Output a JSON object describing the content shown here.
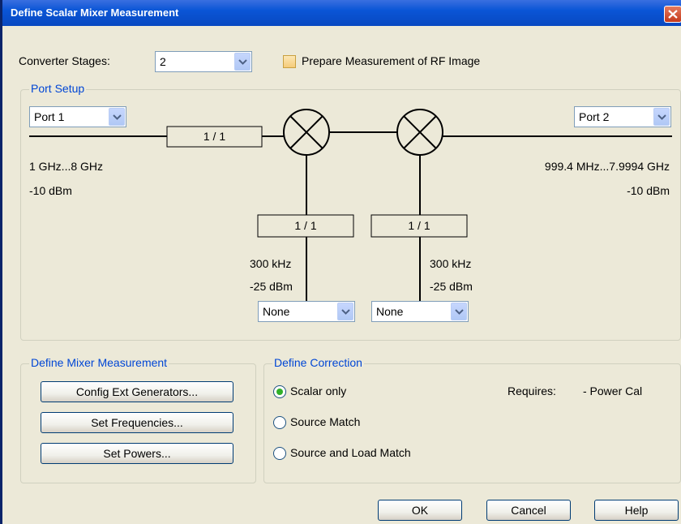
{
  "window": {
    "title": "Define Scalar Mixer Measurement"
  },
  "converter": {
    "label": "Converter Stages:",
    "value": "2"
  },
  "rf_image": {
    "label": "Prepare Measurement of RF Image",
    "checked": false
  },
  "port_setup": {
    "title": "Port Setup",
    "port_in": "Port 1",
    "port_out": "Port 2",
    "in_freq": "1 GHz...8 GHz",
    "in_power": "-10 dBm",
    "out_freq": "999.4 MHz...7.9994 GHz",
    "out_power": "-10 dBm",
    "ratio_in": "1 / 1",
    "lo1": {
      "ratio": "1 / 1",
      "freq": "300 kHz",
      "power": "-25 dBm",
      "source": "None"
    },
    "lo2": {
      "ratio": "1 / 1",
      "freq": "300 kHz",
      "power": "-25 dBm",
      "source": "None"
    }
  },
  "mixer_group": {
    "title": "Define Mixer Measurement",
    "buttons": [
      "Config Ext Generators...",
      "Set Frequencies...",
      "Set Powers..."
    ]
  },
  "correction": {
    "title": "Define Correction",
    "options": [
      "Scalar only",
      "Source Match",
      "Source and Load Match"
    ],
    "selected": "Scalar only",
    "requires_label": "Requires:",
    "requires_value": "- Power Cal"
  },
  "footer": {
    "ok": "OK",
    "cancel": "Cancel",
    "help": "Help"
  },
  "colors": {
    "title_bar": "#0A55D6",
    "group_title": "#0046D5",
    "radio_selected": "#31B02A"
  }
}
